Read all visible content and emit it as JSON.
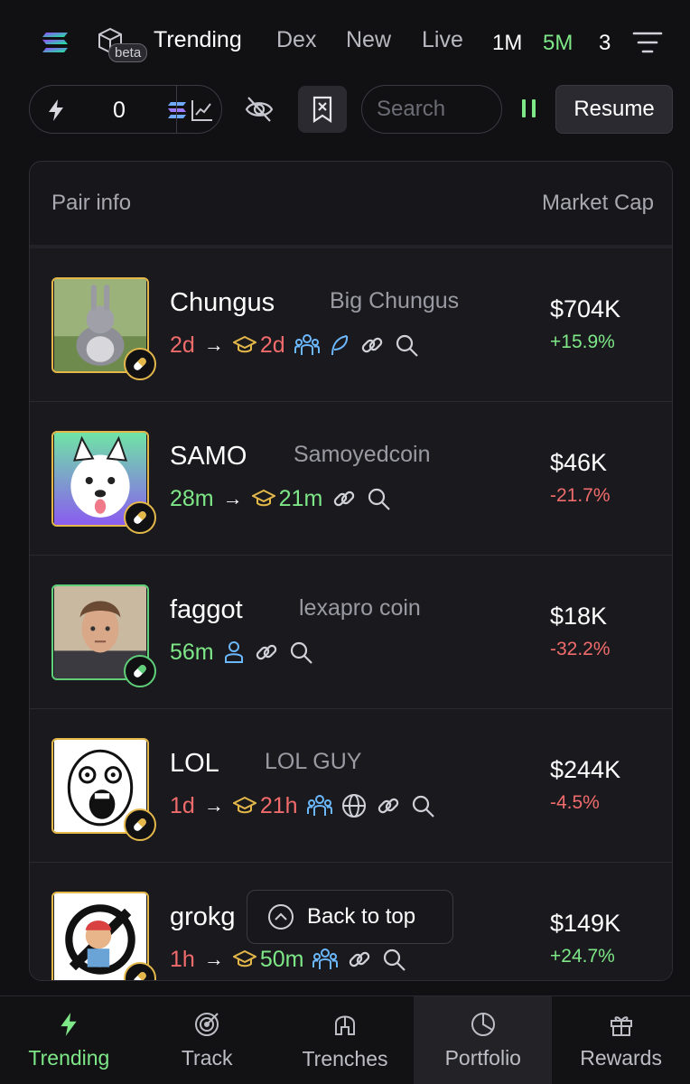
{
  "nav": {
    "beta_label": "beta",
    "tabs": [
      "Trending",
      "Dex",
      "New",
      "Live"
    ],
    "timeframes": [
      "1M",
      "5M",
      "3"
    ]
  },
  "toolbar": {
    "quickbuy_amount": "0",
    "search_placeholder": "Search",
    "resume_label": "Resume"
  },
  "table": {
    "col_pair": "Pair info",
    "col_mcap": "Market Cap",
    "rows": [
      {
        "ticker": "Chungus",
        "name": "Big Chungus",
        "age": "2d",
        "grad_age": "2d",
        "mcap": "$704K",
        "change": "+15.9%"
      },
      {
        "ticker": "SAMO",
        "name": "Samoyedcoin",
        "age": "28m",
        "grad_age": "21m",
        "mcap": "$46K",
        "change": "-21.7%"
      },
      {
        "ticker": "faggot",
        "name": "lexapro coin",
        "age": "56m",
        "grad_age": "",
        "mcap": "$18K",
        "change": "-32.2%"
      },
      {
        "ticker": "LOL",
        "name": "LOL GUY",
        "age": "1d",
        "grad_age": "21h",
        "mcap": "$244K",
        "change": "-4.5%"
      },
      {
        "ticker": "grokg",
        "name": "",
        "age": "1h",
        "grad_age": "50m",
        "mcap": "$149K",
        "change": "+24.7%"
      }
    ]
  },
  "back_to_top": "Back to top",
  "bottom_nav": [
    "Trending",
    "Track",
    "Trenches",
    "Portfolio",
    "Rewards"
  ],
  "colors": {
    "accent_green": "#7ee787",
    "red": "#f06b6b",
    "gold": "#e3b74a",
    "bg": "#111114"
  }
}
